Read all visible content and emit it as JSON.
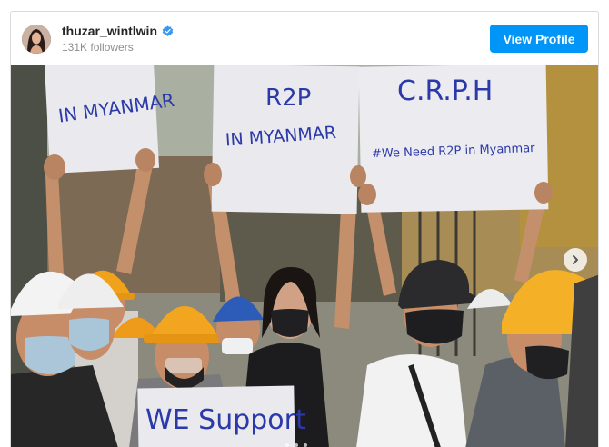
{
  "profile": {
    "username": "thuzar_wintlwin",
    "verified": true,
    "followers": "131K followers",
    "view_profile_label": "View Profile"
  },
  "post": {
    "signs": {
      "left": "IN MYANMAR",
      "center_top": "R2P",
      "center_bottom": "IN MYANMAR",
      "right_top": "C.R.P.H",
      "right_bottom": "#We Need R2P in Myanmar",
      "front": "WE Support"
    }
  },
  "icons": {
    "verified": "verified-badge-icon",
    "next": "chevron-right-icon"
  },
  "colors": {
    "accent": "#0095f6",
    "verified": "#3897f0"
  }
}
